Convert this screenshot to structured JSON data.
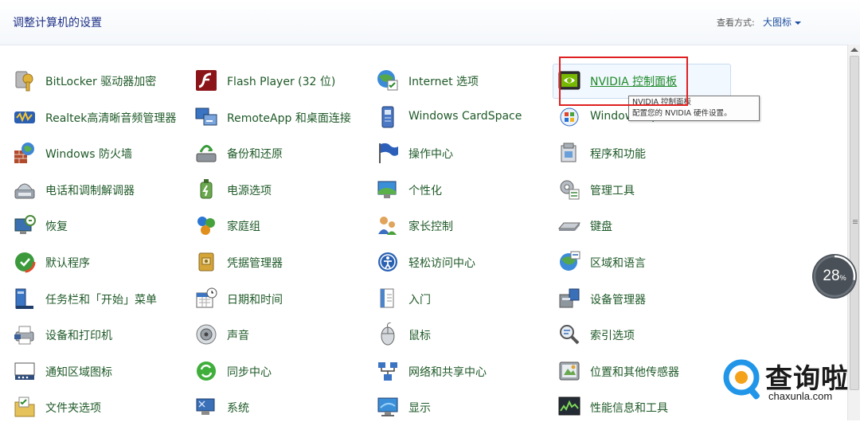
{
  "header": {
    "title": "调整计算机的设置",
    "view_label": "查看方式:",
    "view_value": "大图标"
  },
  "tooltip": {
    "title": "NVIDIA 控制面板",
    "desc": "配置您的 NVIDIA 硬件设置。"
  },
  "columns": [
    [
      {
        "label": "BitLocker 驱动器加密",
        "icon": "bitlocker-key-icon"
      },
      {
        "label": "Realtek高清晰音频管理器",
        "icon": "realtek-audio-icon"
      },
      {
        "label": "Windows 防火墙",
        "icon": "firewall-icon"
      },
      {
        "label": "电话和调制解调器",
        "icon": "phone-modem-icon"
      },
      {
        "label": "恢复",
        "icon": "recovery-icon"
      },
      {
        "label": "默认程序",
        "icon": "default-programs-icon"
      },
      {
        "label": "任务栏和「开始」菜单",
        "icon": "taskbar-icon"
      },
      {
        "label": "设备和打印机",
        "icon": "printer-icon"
      },
      {
        "label": "通知区域图标",
        "icon": "notification-area-icon"
      },
      {
        "label": "文件夹选项",
        "icon": "folder-options-icon"
      }
    ],
    [
      {
        "label": "Flash Player (32 位)",
        "icon": "flash-player-icon"
      },
      {
        "label": "RemoteApp 和桌面连接",
        "icon": "remoteapp-icon"
      },
      {
        "label": "备份和还原",
        "icon": "backup-restore-icon"
      },
      {
        "label": "电源选项",
        "icon": "power-options-icon"
      },
      {
        "label": "家庭组",
        "icon": "homegroup-icon"
      },
      {
        "label": "凭据管理器",
        "icon": "credential-manager-icon"
      },
      {
        "label": "日期和时间",
        "icon": "date-time-icon"
      },
      {
        "label": "声音",
        "icon": "sound-icon"
      },
      {
        "label": "同步中心",
        "icon": "sync-center-icon"
      },
      {
        "label": "系统",
        "icon": "system-icon"
      }
    ],
    [
      {
        "label": "Internet 选项",
        "icon": "internet-options-icon"
      },
      {
        "label": "Windows CardSpace",
        "icon": "cardspace-icon"
      },
      {
        "label": "操作中心",
        "icon": "action-center-flag-icon"
      },
      {
        "label": "个性化",
        "icon": "personalization-icon"
      },
      {
        "label": "家长控制",
        "icon": "parental-controls-icon"
      },
      {
        "label": "轻松访问中心",
        "icon": "ease-of-access-icon"
      },
      {
        "label": "入门",
        "icon": "getting-started-icon"
      },
      {
        "label": "鼠标",
        "icon": "mouse-icon"
      },
      {
        "label": "网络和共享中心",
        "icon": "network-sharing-icon"
      },
      {
        "label": "显示",
        "icon": "display-icon"
      }
    ],
    [
      {
        "label": "NVIDIA 控制面板",
        "icon": "nvidia-icon"
      },
      {
        "label": "Windows Update",
        "icon": "windows-update-icon"
      },
      {
        "label": "程序和功能",
        "icon": "programs-features-icon"
      },
      {
        "label": "管理工具",
        "icon": "admin-tools-icon"
      },
      {
        "label": "键盘",
        "icon": "keyboard-icon"
      },
      {
        "label": "区域和语言",
        "icon": "region-language-icon"
      },
      {
        "label": "设备管理器",
        "icon": "device-manager-icon"
      },
      {
        "label": "索引选项",
        "icon": "indexing-options-icon"
      },
      {
        "label": "位置和其他传感器",
        "icon": "location-sensors-icon"
      },
      {
        "label": "性能信息和工具",
        "icon": "performance-icon"
      }
    ]
  ],
  "badge": {
    "value": "28",
    "unit": "%",
    "progress": 0.28
  },
  "watermark": {
    "name": "查询啦",
    "domain": "chaxunla.com"
  }
}
